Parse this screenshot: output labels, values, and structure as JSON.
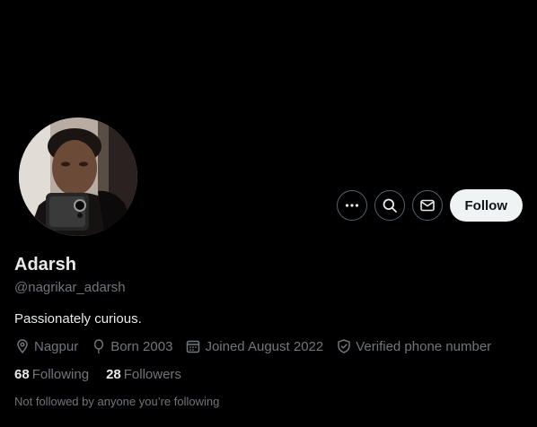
{
  "profile": {
    "name": "Adarsh",
    "handle": "@nagrikar_adarsh",
    "bio": "Passionately curious.",
    "avatar_icon": "profile-photo",
    "meta": {
      "location": "Nagpur",
      "birth": "Born 2003",
      "joined": "Joined August 2022",
      "verified": "Verified phone number"
    },
    "stats": {
      "following_count": "68",
      "following_label": "Following",
      "followers_count": "28",
      "followers_label": "Followers"
    },
    "followed_by_note": "Not followed by anyone you’re following"
  },
  "actions": {
    "more_icon": "more-horizontal-icon",
    "search_icon": "search-icon",
    "message_icon": "envelope-icon",
    "follow_label": "Follow"
  },
  "colors": {
    "background": "#000000",
    "text_primary": "#e7e9ea",
    "text_secondary": "#71767b",
    "button_border": "#536471",
    "follow_bg": "#eff3f4",
    "follow_text": "#0f1419"
  }
}
